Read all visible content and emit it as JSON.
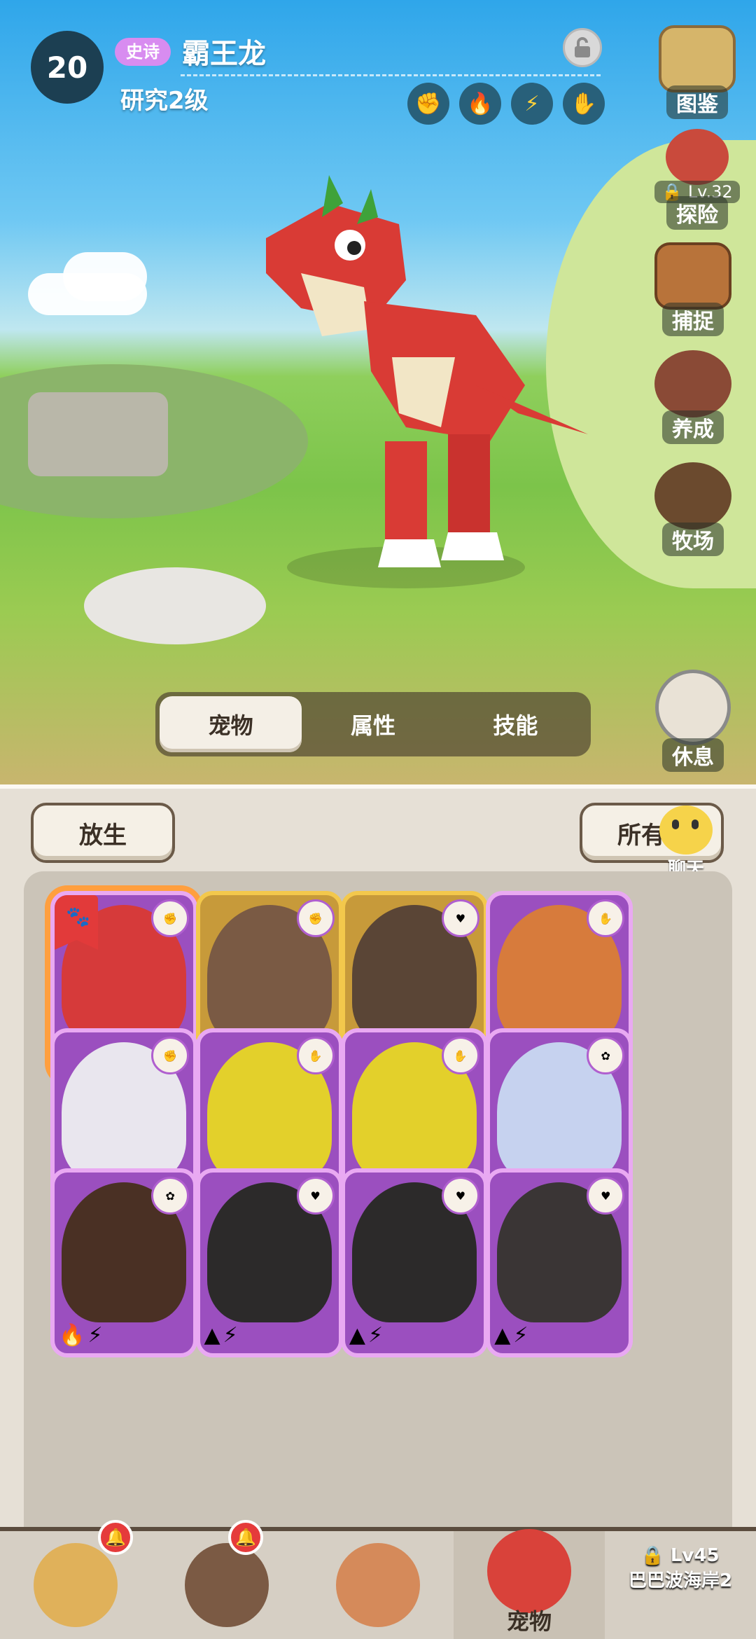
{
  "header": {
    "level": "20",
    "rarity": "史诗",
    "pet_name": "霸王龙",
    "research": "研究2级"
  },
  "attributes": [
    {
      "icon": "beast-icon",
      "glyph": "✊"
    },
    {
      "icon": "fire-icon",
      "glyph": "🔥"
    },
    {
      "icon": "lightning-icon",
      "glyph": "⚡"
    },
    {
      "icon": "mineral-icon",
      "glyph": "✋"
    }
  ],
  "side_menu": {
    "handbook": "图鉴",
    "adventure_lock": "Lv.32",
    "adventure": "探险",
    "capture": "捕捉",
    "breed": "养成",
    "ranch": "牧场",
    "rest": "休息"
  },
  "tabs": [
    "宠物",
    "属性",
    "技能"
  ],
  "panel": {
    "release_button": "放生",
    "filter_button": "所有",
    "chat_label": "聊天"
  },
  "pets": [
    {
      "name": "red-trex",
      "rarity": "epic",
      "top": "✊",
      "bottom": [
        "🔥",
        "⚡"
      ],
      "color": "#d63a3a"
    },
    {
      "name": "brown-bear",
      "rarity": "legend",
      "top": "✊",
      "bottom": [
        "⚡",
        "▲"
      ],
      "color": "#7a5a44"
    },
    {
      "name": "platypus",
      "rarity": "legend",
      "top": "♥",
      "bottom": [
        "▲",
        "❄"
      ],
      "color": "#5a4536"
    },
    {
      "name": "orange-triceratops",
      "rarity": "epic",
      "top": "✋",
      "bottom": [
        "🔥",
        "⚡"
      ],
      "color": "#d77b3c"
    },
    {
      "name": "white-dragon",
      "rarity": "epic",
      "top": "✊",
      "bottom": [
        "❄",
        "🔥"
      ],
      "color": "#e9e6ee"
    },
    {
      "name": "yellow-beast",
      "rarity": "epic",
      "top": "✋",
      "bottom": [
        "⚡",
        "▲"
      ],
      "color": "#e3d02b"
    },
    {
      "name": "yellow-beast-2",
      "rarity": "epic",
      "top": "✋",
      "bottom": [
        "⚡",
        "▲"
      ],
      "color": "#e3d02b"
    },
    {
      "name": "ice-bear",
      "rarity": "epic",
      "top": "✿",
      "bottom": [
        "❄",
        "▲"
      ],
      "color": "#c6d2ef"
    },
    {
      "name": "fire-monkey",
      "rarity": "epic",
      "top": "✿",
      "bottom": [
        "🔥",
        "⚡"
      ],
      "color": "#4a3024"
    },
    {
      "name": "warthog",
      "rarity": "epic",
      "top": "♥",
      "bottom": [
        "▲",
        "⚡"
      ],
      "color": "#2c2a2a"
    },
    {
      "name": "warthog-2",
      "rarity": "epic",
      "top": "♥",
      "bottom": [
        "▲",
        "⚡"
      ],
      "color": "#2c2a2a"
    },
    {
      "name": "boar",
      "rarity": "epic",
      "top": "♥",
      "bottom": [
        "▲",
        "⚡"
      ],
      "color": "#3a3535"
    }
  ],
  "nav": {
    "pets_label": "宠物",
    "locked_level": "Lv45",
    "locked_area": "巴巴波海岸2"
  },
  "colors": {
    "panel": "#e6e0d6",
    "card_epic": "#9b4fbf",
    "card_legend": "#c79a3a",
    "accent": "#ff9f3f"
  }
}
